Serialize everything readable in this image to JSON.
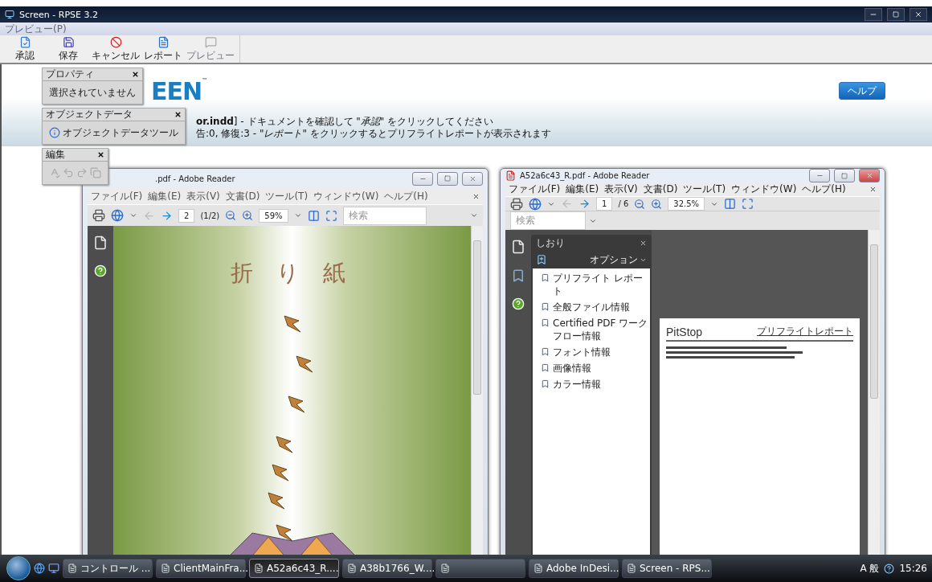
{
  "window": {
    "title": "Screen - RPSE 3.2"
  },
  "menu": [
    {
      "label": "プレビュー(P)",
      "disabled": true
    }
  ],
  "toolbar": [
    {
      "label": "承認",
      "kind": "approve",
      "disabled": false
    },
    {
      "label": "保存",
      "kind": "save",
      "disabled": false
    },
    {
      "label": "キャンセル",
      "kind": "cancel",
      "disabled": false
    },
    {
      "label": "レポート",
      "kind": "report",
      "disabled": false
    },
    {
      "label": "プレビュー",
      "kind": "preview",
      "disabled": true
    }
  ],
  "banner": {
    "logo": "EEN",
    "trademark": "™",
    "message_lines": [
      "**or.indd**] - ドキュメントを確認して *\"承認\"* をクリックしてください",
      "告:0, 修復:3 - *\"レポート\"* をクリックするとプリフライトレポートが表示されます"
    ],
    "help_button": "ヘルプ"
  },
  "panels": [
    {
      "title": "プロパティ",
      "kind": "text",
      "text": "選択されていません"
    },
    {
      "title": "オブジェクトデータ",
      "kind": "tool",
      "text": "オブジェクトデータツール"
    },
    {
      "title": "編集",
      "kind": "icons"
    }
  ],
  "readers": [
    {
      "title": ".pdf - Adobe Reader",
      "kind": "cover",
      "menu": [
        "ファイル(F)",
        "編集(E)",
        "表示(V)",
        "文書(D)",
        "ツール(T)",
        "ウィンドウ(W)",
        "ヘルプ(H)"
      ],
      "page": "2",
      "page_count": "(1/2)",
      "zoom": "59%",
      "search_placeholder": "検索",
      "cover_title": "折 り 紙"
    },
    {
      "title": "A52a6c43_R.pdf - Adobe Reader",
      "kind": "bookmarks",
      "menu": [
        "ファイル(F)",
        "編集(E)",
        "表示(V)",
        "文書(D)",
        "ツール(T)",
        "ウィンドウ(W)",
        "ヘルプ(H)"
      ],
      "page": "1",
      "page_count": "/ 6",
      "zoom": "32.5%",
      "search_placeholder": "検索",
      "bookmarks": {
        "title": "しおり",
        "options": "オプション",
        "items": [
          "プリフライト レポート",
          "全般ファイル情報",
          "Certified PDF ワークフロー情報",
          "フォント情報",
          "画像情報",
          "カラー情報"
        ]
      },
      "report": {
        "brand": "PitStop",
        "heading": "プリフライトレポート"
      }
    }
  ],
  "taskbar": {
    "tasks": [
      {
        "label": "コントロール ...",
        "selected": false
      },
      {
        "label": "ClientMainFra...",
        "selected": false
      },
      {
        "label": "A52a6c43_R....",
        "selected": true
      },
      {
        "label": "A38b1766_W....",
        "selected": false
      },
      {
        "selected": false
      },
      {
        "label": "Adobe InDesi...",
        "selected": false
      },
      {
        "label": "Screen - RPS...",
        "selected": false
      }
    ],
    "ime": "A 般",
    "clock": "15:26"
  }
}
